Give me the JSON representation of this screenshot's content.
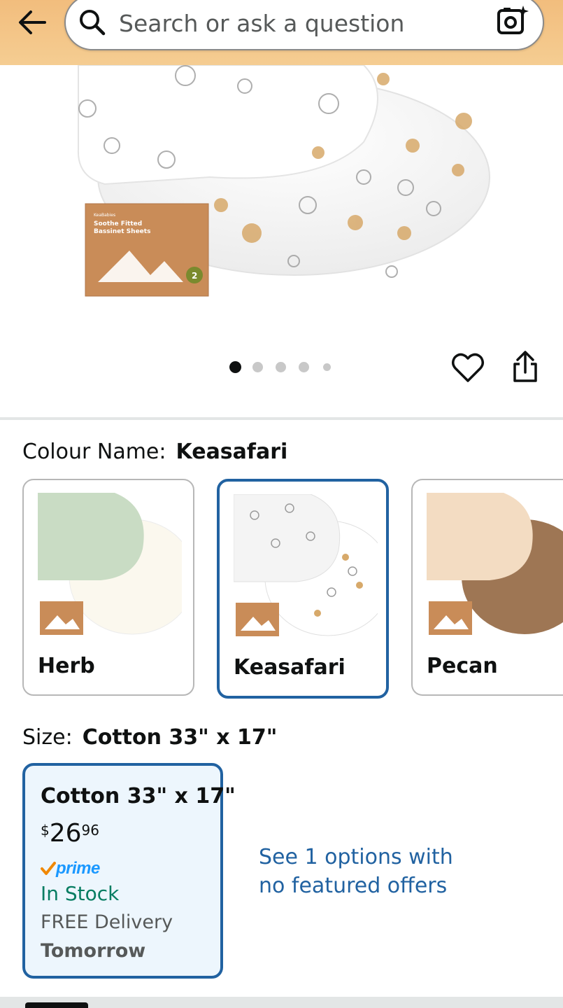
{
  "header": {
    "back_icon": "arrow-left-icon",
    "search_placeholder": "Search or ask a question",
    "camera_icon": "camera-sparkle-icon",
    "background_color": "#f3c383"
  },
  "product_image": {
    "packaging_brand": "KeaBabies",
    "packaging_title_line1": "Soothe Fitted",
    "packaging_title_line2": "Bassinet Sheets"
  },
  "carousel": {
    "total_dots": 5,
    "active_index": 0
  },
  "actions": {
    "wishlist_icon": "heart-icon",
    "share_icon": "share-icon"
  },
  "colour": {
    "label": "Colour Name:",
    "selected": "Keasafari",
    "options": [
      {
        "name": "Herb",
        "selected": false,
        "colors": [
          "#c9dcc4",
          "#fbf8ee"
        ]
      },
      {
        "name": "Keasafari",
        "selected": true,
        "colors": [
          "#f4f4f4",
          "#ffffff"
        ]
      },
      {
        "name": "Pecan",
        "selected": false,
        "colors": [
          "#f3dcc2",
          "#9e7654"
        ]
      }
    ]
  },
  "size": {
    "label": "Size:",
    "selected": "Cotton 33\" x 17\"",
    "card": {
      "title": "Cotton 33\" x 17\"",
      "price_symbol": "$",
      "price_whole": "26",
      "price_fraction": "96",
      "prime_label": "prime",
      "stock": "In Stock",
      "delivery": "FREE Delivery",
      "delivery_day": "Tomorrow"
    },
    "other_options_link_line1": "See 1 options with",
    "other_options_link_line2": "no featured offers"
  },
  "colors": {
    "accent": "#2162a1",
    "in_stock": "#067d62",
    "prime": "#1a98ff",
    "card_bg": "#edf6fd"
  }
}
